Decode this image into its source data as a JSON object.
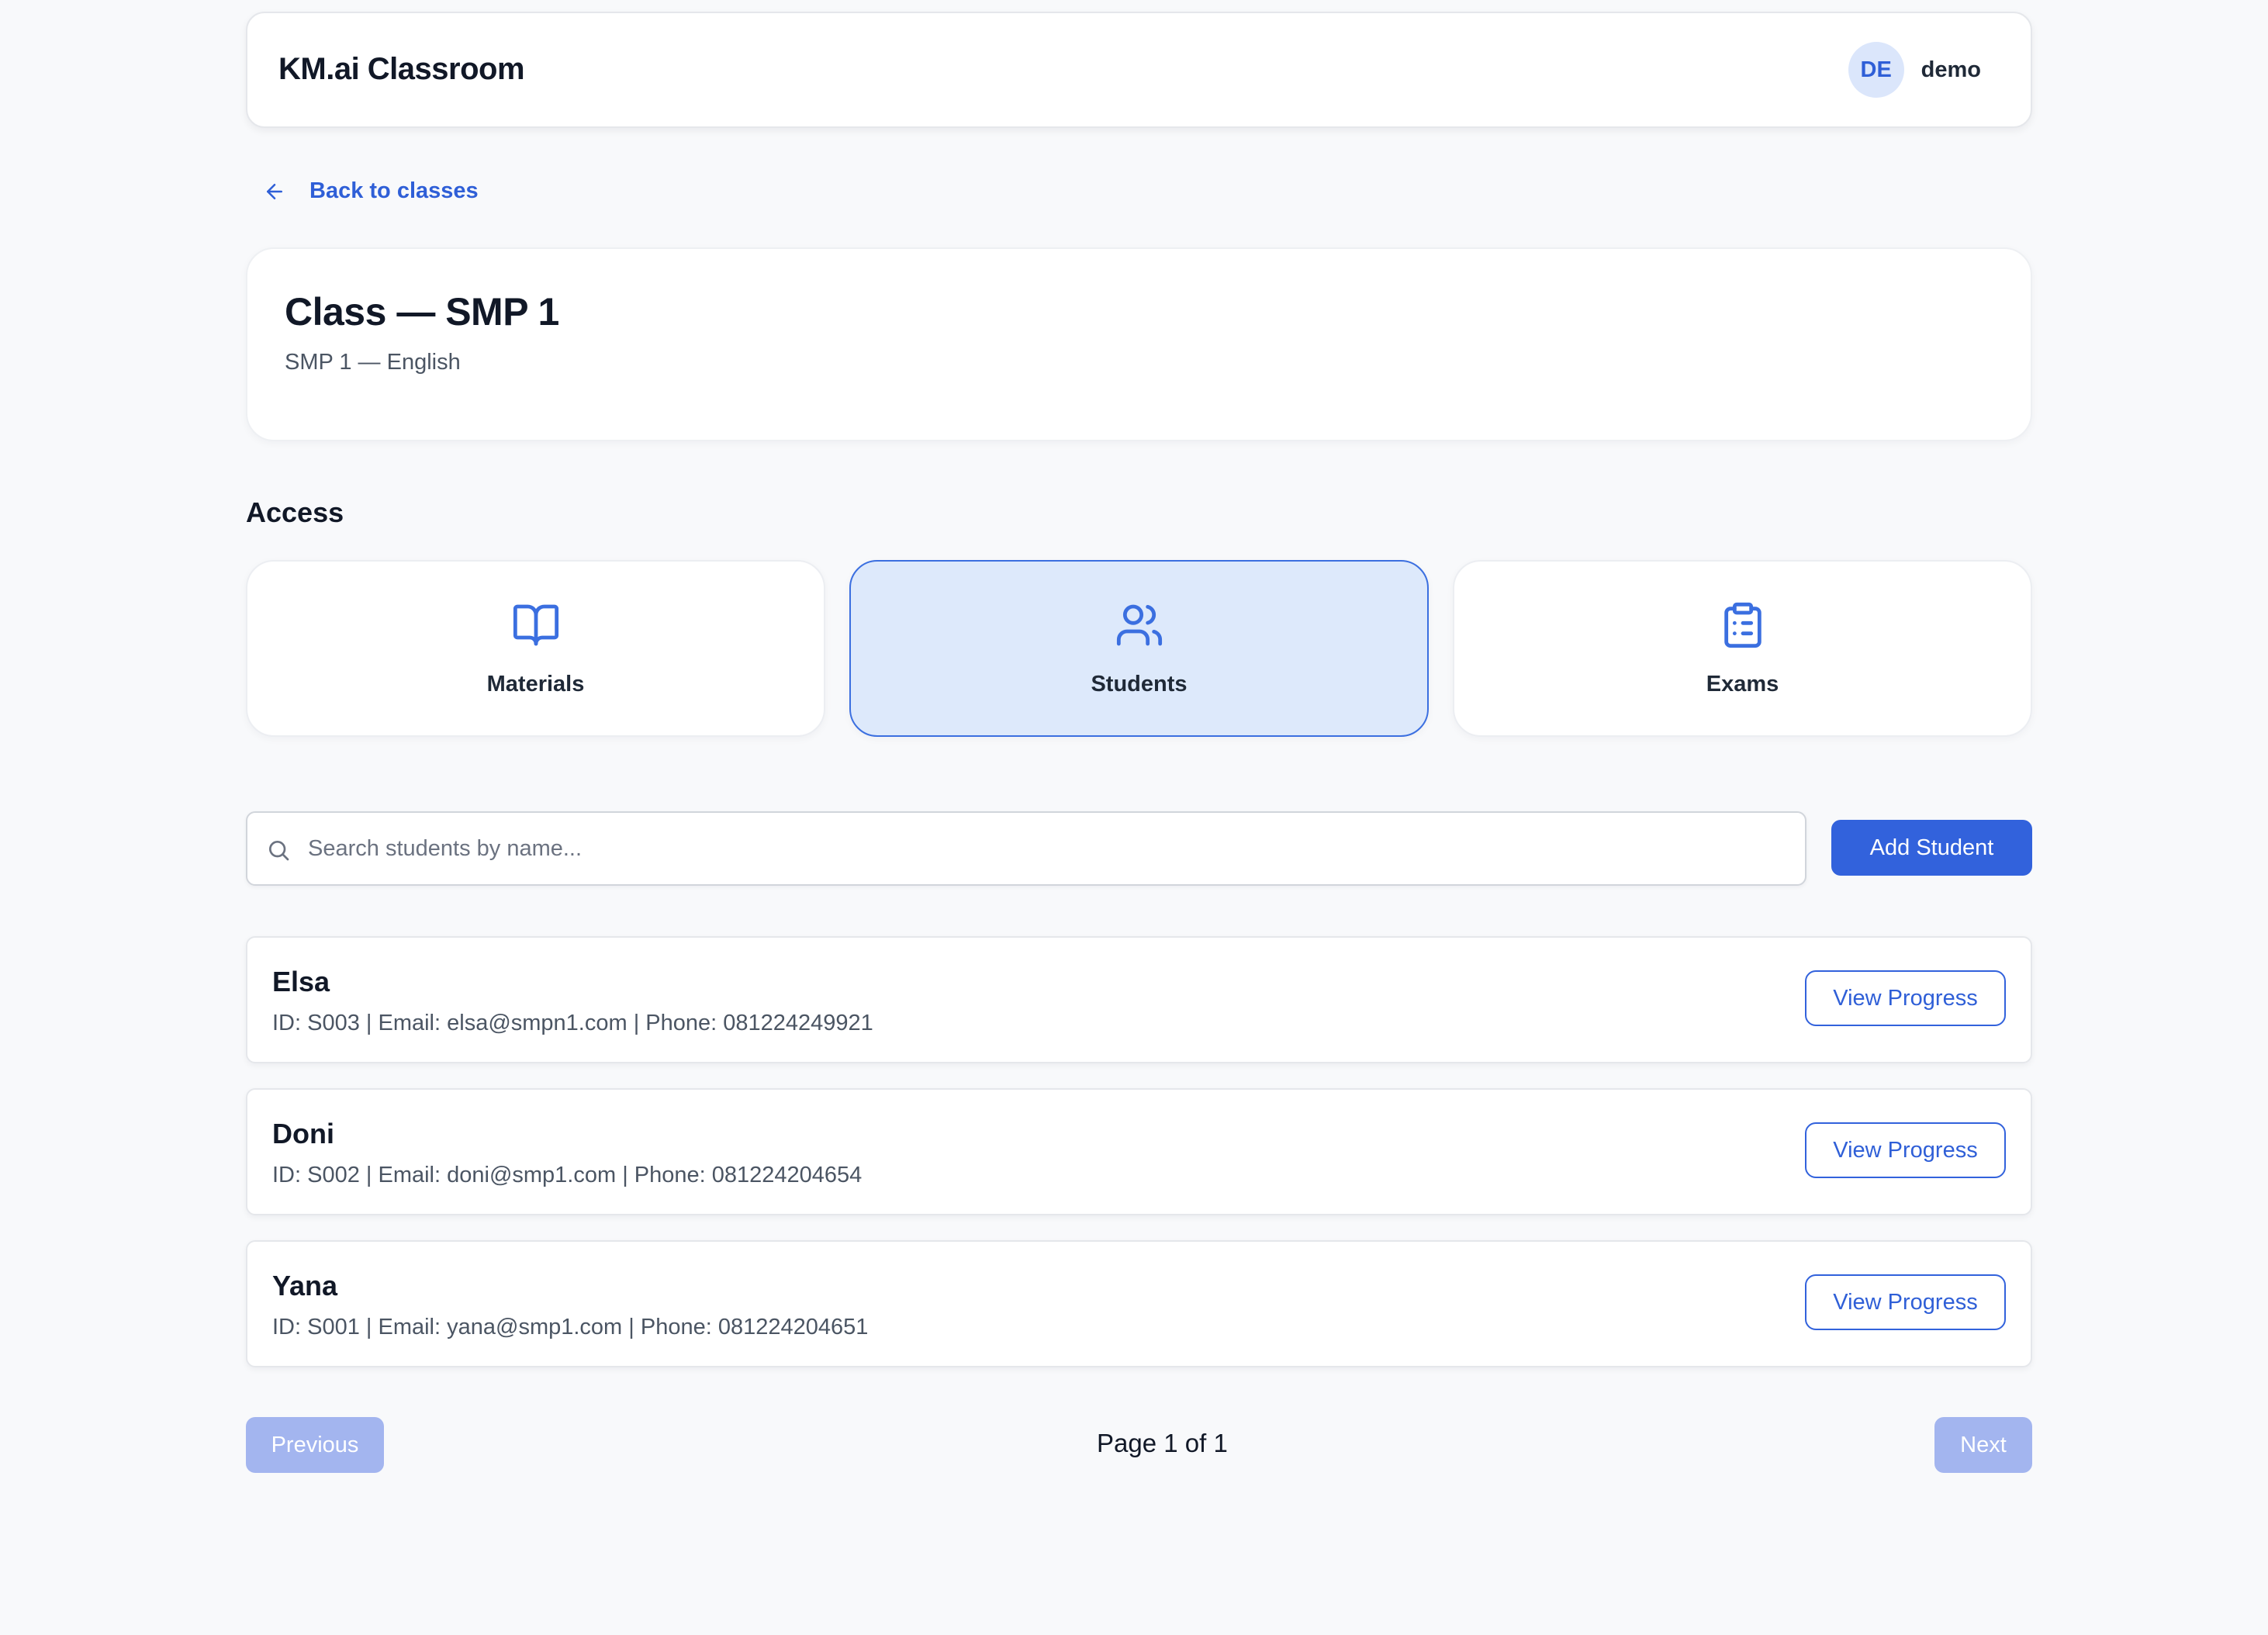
{
  "header": {
    "brand": "KM.ai Classroom",
    "avatar_initials": "DE",
    "username": "demo"
  },
  "nav": {
    "back_label": "Back to classes"
  },
  "class_info": {
    "title": "Class — SMP 1",
    "subtitle": "SMP 1 — English"
  },
  "access": {
    "heading": "Access",
    "tabs": [
      {
        "label": "Materials",
        "icon": "book-open-icon",
        "active": false
      },
      {
        "label": "Students",
        "icon": "users-icon",
        "active": true
      },
      {
        "label": "Exams",
        "icon": "clipboard-list-icon",
        "active": false
      }
    ]
  },
  "search": {
    "placeholder": "Search students by name...",
    "value": ""
  },
  "actions": {
    "add_student_label": "Add Student"
  },
  "students": [
    {
      "name": "Elsa",
      "details": "ID: S003 | Email: elsa@smpn1.com | Phone: 081224249921",
      "action_label": "View Progress"
    },
    {
      "name": "Doni",
      "details": "ID: S002 | Email: doni@smp1.com | Phone: 081224204654",
      "action_label": "View Progress"
    },
    {
      "name": "Yana",
      "details": "ID: S001 | Email: yana@smp1.com | Phone: 081224204651",
      "action_label": "View Progress"
    }
  ],
  "pagination": {
    "previous_label": "Previous",
    "page_info": "Page 1 of 1",
    "next_label": "Next"
  },
  "colors": {
    "accent": "#3262dc",
    "active_tab_bg": "#dde9fb",
    "disabled_button": "#a3b5ef",
    "page_bg": "#f8f9fb"
  }
}
